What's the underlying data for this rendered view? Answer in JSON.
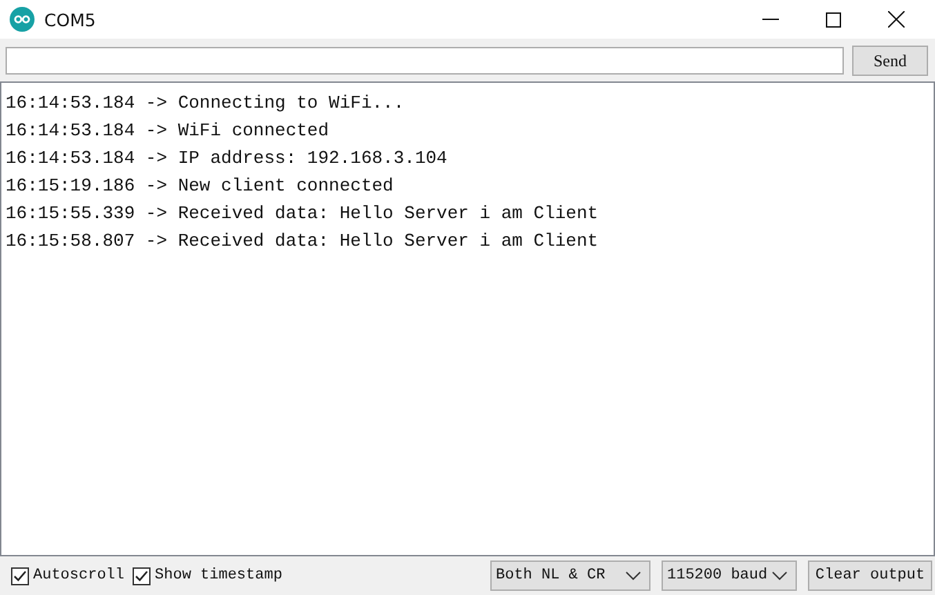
{
  "window": {
    "title": "COM5"
  },
  "send_button": "Send",
  "log_lines": [
    "16:14:53.184 -> Connecting to WiFi...",
    "16:14:53.184 -> WiFi connected",
    "16:14:53.184 -> IP address: 192.168.3.104",
    "16:15:19.186 -> New client connected",
    "16:15:55.339 -> Received data: Hello Server i am Client",
    "16:15:58.807 -> Received data: Hello Server i am Client"
  ],
  "options": [
    {
      "label": "Autoscroll",
      "checked": true
    },
    {
      "label": "Show timestamp",
      "checked": true
    }
  ],
  "line_ending": "Both NL & CR",
  "baud_rate": "115200 baud",
  "clear_button": "Clear output"
}
